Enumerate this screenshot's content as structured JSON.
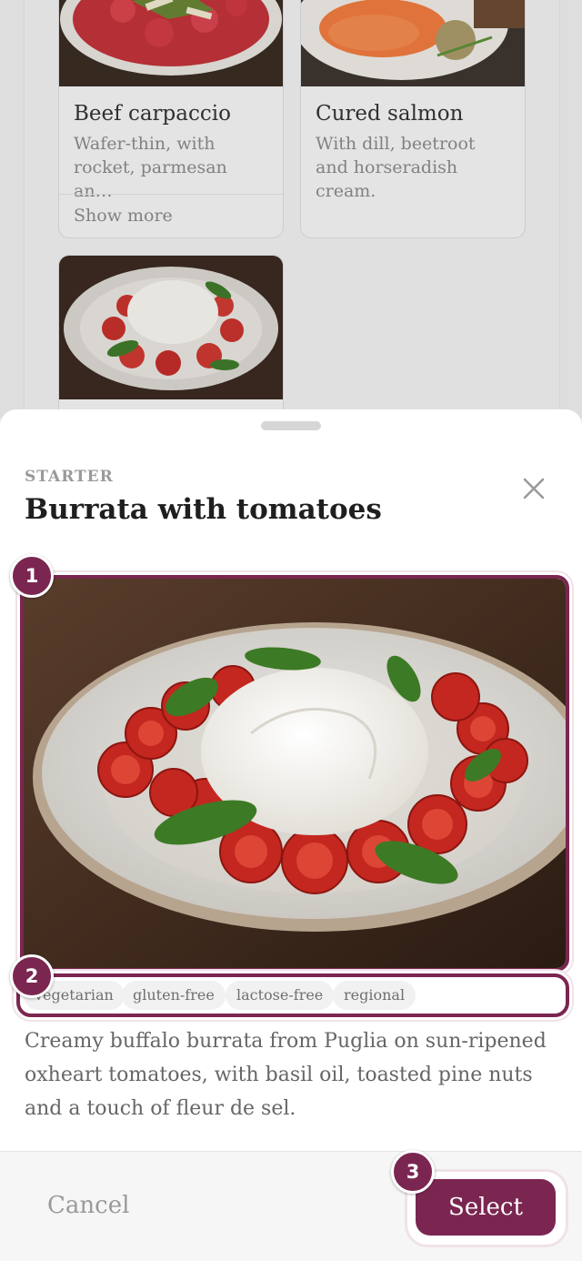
{
  "background_cards": [
    {
      "title": "Beef carpaccio",
      "description": "Wafer-thin, with rocket, parmesan an…",
      "show_more": "Show more"
    },
    {
      "title": "Cured salmon",
      "description": "With dill, beetroot and horseradish cream."
    },
    {
      "title": ""
    }
  ],
  "sheet": {
    "eyebrow": "STARTER",
    "title": "Burrata with tomatoes",
    "tags": [
      "vegetarian",
      "gluten-free",
      "lactose-free",
      "regional"
    ],
    "description": "Creamy buffalo burrata from Puglia on sun-ripened oxheart tomatoes, with basil oil, toasted pine nuts and a touch of fleur de sel.",
    "cancel_label": "Cancel",
    "select_label": "Select"
  },
  "markers": [
    "1",
    "2",
    "3"
  ],
  "colors": {
    "accent": "#7b2651"
  },
  "icons": {
    "close": "close-icon"
  }
}
